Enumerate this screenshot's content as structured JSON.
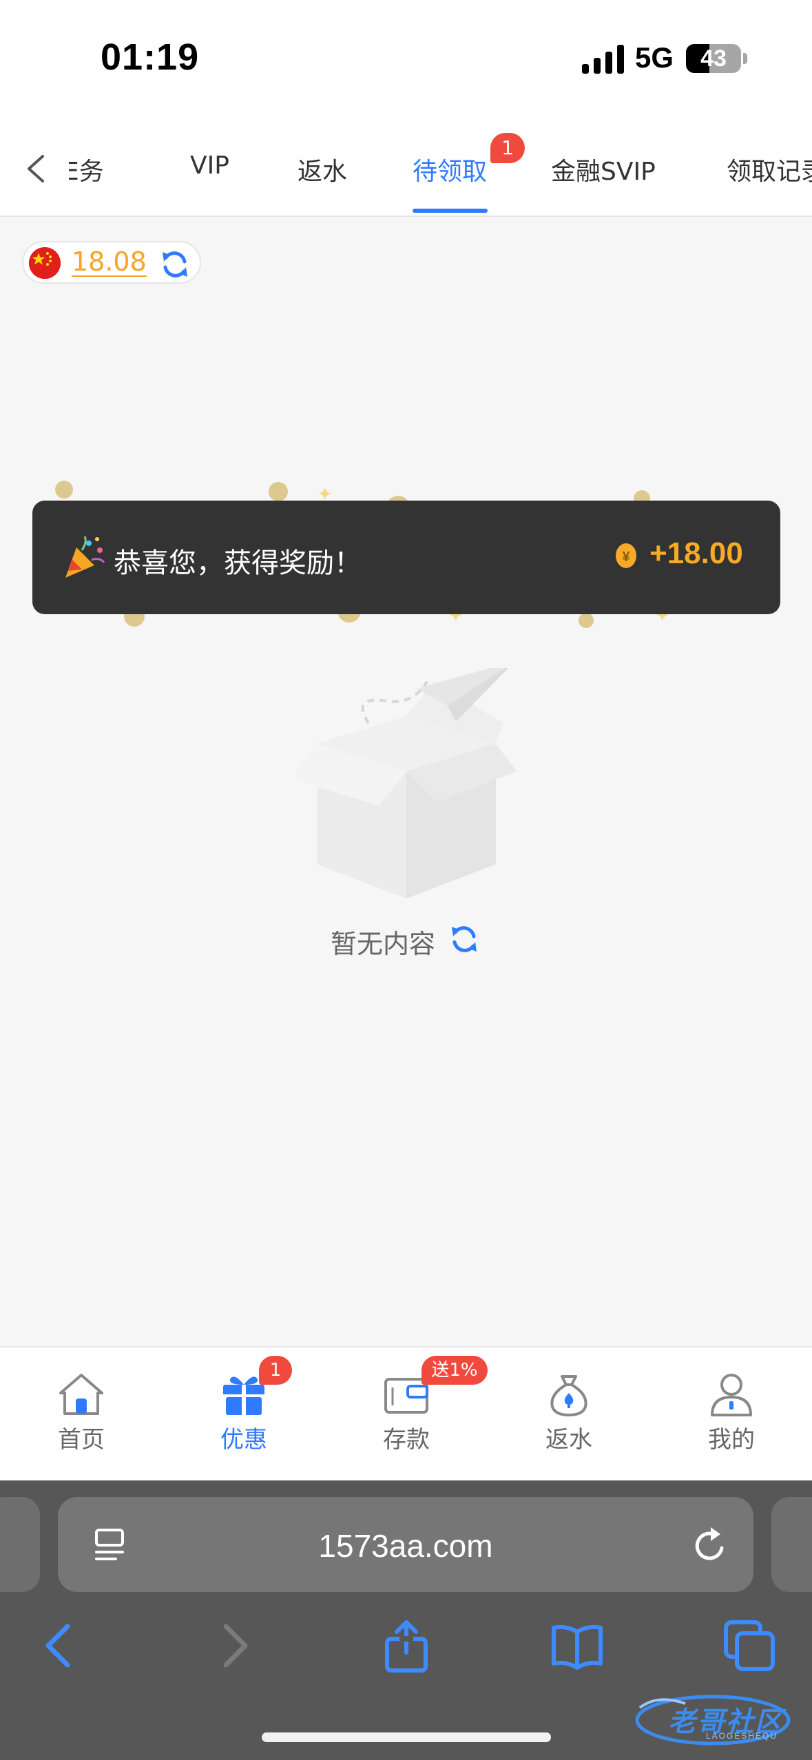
{
  "status_bar": {
    "time": "01:19",
    "network": "5G",
    "battery_level": "43",
    "battery_fraction": 0.43
  },
  "tabs": {
    "items": [
      {
        "label": "任务",
        "visible_text": "E务",
        "active": false
      },
      {
        "label": "VIP",
        "active": false
      },
      {
        "label": "返水",
        "active": false
      },
      {
        "label": "待领取",
        "active": true,
        "badge": "1"
      },
      {
        "label": "金融SVIP",
        "active": false
      },
      {
        "label": "领取记录",
        "active": false
      }
    ]
  },
  "balance": {
    "currency_flag": "china-flag-icon",
    "amount": "18.08"
  },
  "reward_toast": {
    "message": "恭喜您，获得奖励！",
    "amount": "+18.00"
  },
  "empty_state": {
    "text": "暂无内容"
  },
  "bottom_nav": {
    "items": [
      {
        "label": "首页",
        "icon": "home-icon",
        "active": false
      },
      {
        "label": "优惠",
        "icon": "gift-icon",
        "active": true,
        "badge": "1"
      },
      {
        "label": "存款",
        "icon": "wallet-icon",
        "active": false,
        "badge": "送1%"
      },
      {
        "label": "返水",
        "icon": "money-bag-icon",
        "active": false
      },
      {
        "label": "我的",
        "icon": "user-icon",
        "active": false
      }
    ]
  },
  "browser": {
    "url": "1573aa.com"
  },
  "watermark": {
    "text": "老哥社区",
    "subtext": "LAOGESHEQU"
  },
  "colors": {
    "accent": "#2f7bff",
    "badge": "#f04a3e",
    "gold": "#f5a623",
    "toast_bg": "#333333"
  }
}
